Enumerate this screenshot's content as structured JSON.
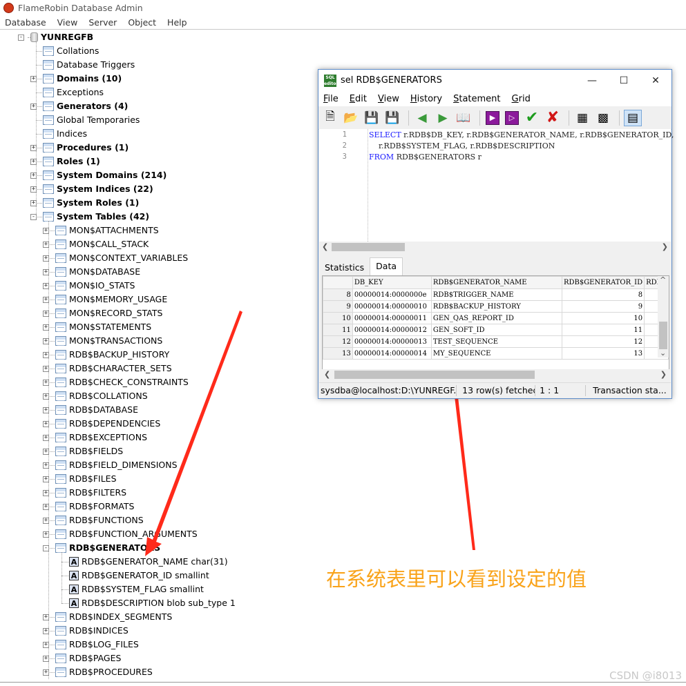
{
  "window": {
    "title": "FlameRobin Database Admin"
  },
  "menu": [
    "Database",
    "View",
    "Server",
    "Object",
    "Help"
  ],
  "tree": {
    "root": "YUNREGFB",
    "nodes": [
      {
        "label": "Collations",
        "icon": "collations-icon",
        "bold": false
      },
      {
        "label": "Database Triggers",
        "icon": "trigger-icon",
        "bold": false
      },
      {
        "label": "Domains (10)",
        "icon": "domains-icon",
        "bold": true
      },
      {
        "label": "Exceptions",
        "icon": "warning-icon",
        "bold": false
      },
      {
        "label": "Generators (4)",
        "icon": "generator-icon",
        "bold": true
      },
      {
        "label": "Global Temporaries",
        "icon": "temp-table-icon",
        "bold": false
      },
      {
        "label": "Indices",
        "icon": "index-icon",
        "bold": false
      },
      {
        "label": "Procedures (1)",
        "icon": "procedure-icon",
        "bold": true
      },
      {
        "label": "Roles (1)",
        "icon": "role-icon",
        "bold": true
      },
      {
        "label": "System Domains (214)",
        "icon": "domains-icon",
        "bold": true
      },
      {
        "label": "System Indices (22)",
        "icon": "index-icon",
        "bold": true
      },
      {
        "label": "System Roles (1)",
        "icon": "role-icon",
        "bold": true
      },
      {
        "label": "System Tables (42)",
        "icon": "table-icon",
        "bold": true
      }
    ],
    "tables_before": [
      "MON$ATTACHMENTS",
      "MON$CALL_STACK",
      "MON$CONTEXT_VARIABLES",
      "MON$DATABASE",
      "MON$IO_STATS",
      "MON$MEMORY_USAGE",
      "MON$RECORD_STATS",
      "MON$STATEMENTS",
      "MON$TRANSACTIONS",
      "RDB$BACKUP_HISTORY",
      "RDB$CHARACTER_SETS",
      "RDB$CHECK_CONSTRAINTS",
      "RDB$COLLATIONS",
      "RDB$DATABASE",
      "RDB$DEPENDENCIES",
      "RDB$EXCEPTIONS",
      "RDB$FIELDS",
      "RDB$FIELD_DIMENSIONS",
      "RDB$FILES",
      "RDB$FILTERS",
      "RDB$FORMATS",
      "RDB$FUNCTIONS",
      "RDB$FUNCTION_ARGUMENTS"
    ],
    "expanded_table": "RDB$GENERATORS",
    "columns": [
      "RDB$GENERATOR_NAME char(31)",
      "RDB$GENERATOR_ID smallint",
      "RDB$SYSTEM_FLAG smallint",
      "RDB$DESCRIPTION blob sub_type 1"
    ],
    "tables_after": [
      "RDB$INDEX_SEGMENTS",
      "RDB$INDICES",
      "RDB$LOG_FILES",
      "RDB$PAGES",
      "RDB$PROCEDURES"
    ]
  },
  "sql_window": {
    "title": "sel RDB$GENERATORS",
    "icon_text": "SQL editor",
    "menu": [
      {
        "u": "F",
        "rest": "ile"
      },
      {
        "u": "E",
        "rest": "dit"
      },
      {
        "u": "V",
        "rest": "iew"
      },
      {
        "u": "H",
        "rest": "istory"
      },
      {
        "u": "S",
        "rest": "tatement"
      },
      {
        "u": "G",
        "rest": "rid"
      }
    ],
    "editor_lines": [
      {
        "n": "1",
        "kw": "SELECT",
        "text": " r.RDB$DB_KEY, r.RDB$GENERATOR_NAME, r.RDB$GENERATOR_ID,"
      },
      {
        "n": "2",
        "kw": "",
        "text": "    r.RDB$SYSTEM_FLAG, r.RDB$DESCRIPTION"
      },
      {
        "n": "3",
        "kw": "FROM",
        "text": " RDB$GENERATORS r"
      }
    ],
    "tabs": [
      "Statistics",
      "Data"
    ],
    "grid": {
      "headers": [
        "DB_KEY",
        "RDB$GENERATOR_NAME",
        "RDB$GENERATOR_ID",
        "RDB$"
      ],
      "rows": [
        {
          "rn": "8",
          "key": "00000014:0000000e",
          "name": "RDB$TRIGGER_NAME",
          "id": "8"
        },
        {
          "rn": "9",
          "key": "00000014:00000010",
          "name": "RDB$BACKUP_HISTORY",
          "id": "9"
        },
        {
          "rn": "10",
          "key": "00000014:00000011",
          "name": "GEN_QAS_REPORT_ID",
          "id": "10"
        },
        {
          "rn": "11",
          "key": "00000014:00000012",
          "name": "GEN_SOFT_ID",
          "id": "11"
        },
        {
          "rn": "12",
          "key": "00000014:00000013",
          "name": "TEST_SEQUENCE",
          "id": "12"
        },
        {
          "rn": "13",
          "key": "00000014:00000014",
          "name": "MY_SEQUENCE",
          "id": "13"
        }
      ]
    },
    "status": [
      "sysdba@localhost:D:\\YUNREGF...",
      "13 row(s) fetched",
      "1 : 1",
      "Transaction sta..."
    ]
  },
  "annotation": "在系统表里可以看到设定的值",
  "watermark": "CSDN @i8013",
  "colors": {
    "arrow": "#ff2a1a",
    "annotation": "#f9a31a",
    "keyword": "#1a1aff"
  }
}
